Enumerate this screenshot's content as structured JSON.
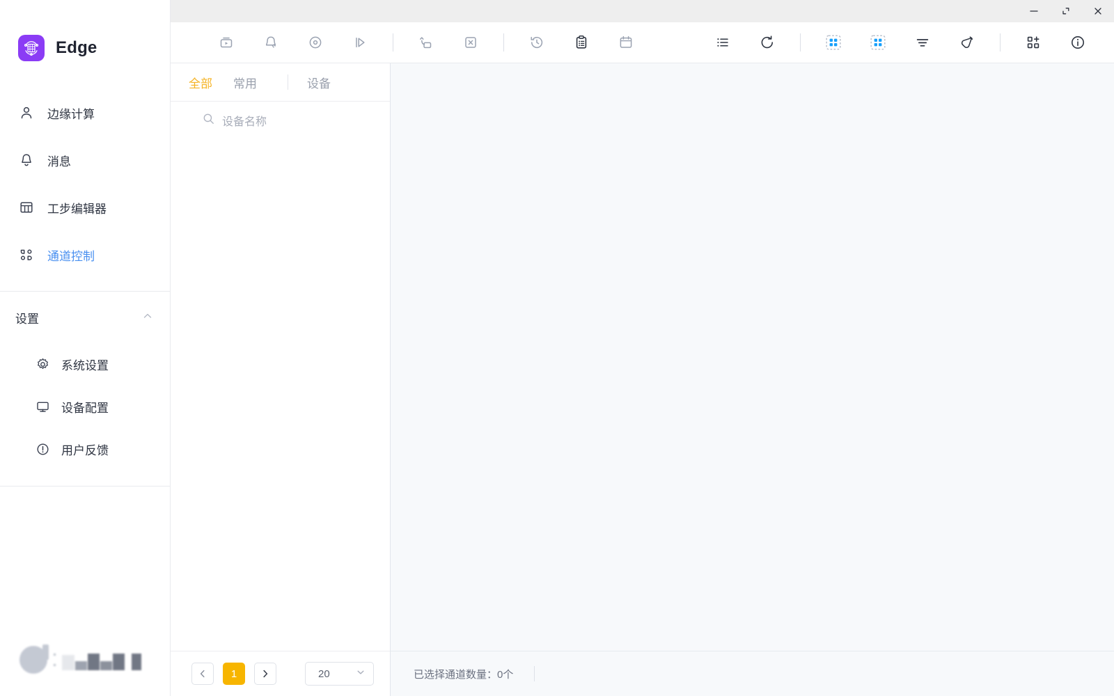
{
  "window": {
    "minimize_label": "minimize",
    "maximize_label": "maximize",
    "close_label": "close"
  },
  "brand": {
    "name": "Edge",
    "logo_color": "#8b3cf5",
    "logo_icon": "server-rotate-icon"
  },
  "sidebar": {
    "items": [
      {
        "label": "边缘计算",
        "icon": "user-icon",
        "active": false
      },
      {
        "label": "消息",
        "icon": "bell-icon",
        "active": false
      },
      {
        "label": "工步编辑器",
        "icon": "table-icon",
        "active": false
      },
      {
        "label": "通道控制",
        "icon": "channels-icon",
        "active": true
      }
    ],
    "settings": {
      "label": "设置",
      "collapse_icon": "chevron-up-icon",
      "items": [
        {
          "label": "系统设置",
          "icon": "gear-icon"
        },
        {
          "label": "设备配置",
          "icon": "monitor-icon"
        },
        {
          "label": "用户反馈",
          "icon": "exclamation-circle-icon"
        }
      ]
    },
    "active_color": "#4a90f0"
  },
  "toolbar": {
    "groups": [
      [
        {
          "name": "play-box-icon"
        },
        {
          "name": "bell-slash-icon"
        },
        {
          "name": "record-circle-icon"
        },
        {
          "name": "step-forward-icon"
        }
      ],
      [
        {
          "name": "export-icon"
        },
        {
          "name": "close-box-icon"
        }
      ],
      [
        {
          "name": "history-icon"
        },
        {
          "name": "clipboard-list-icon"
        },
        {
          "name": "calendar-icon"
        }
      ]
    ],
    "right_groups": [
      [
        {
          "name": "list-icon"
        },
        {
          "name": "reset-icon"
        }
      ],
      [
        {
          "name": "grid-select-icon",
          "highlight": true
        },
        {
          "name": "grid-deselect-icon",
          "highlight": true
        },
        {
          "name": "filter-icon"
        },
        {
          "name": "brush-icon"
        }
      ],
      [
        {
          "name": "add-grid-icon"
        },
        {
          "name": "info-icon"
        }
      ]
    ],
    "highlight_color": "#18a0fb"
  },
  "panel": {
    "tabs": [
      {
        "label": "全部",
        "active": true
      },
      {
        "label": "常用",
        "active": false
      }
    ],
    "device_tab": {
      "label": "设备"
    },
    "search": {
      "placeholder": "设备名称",
      "value": "",
      "icon": "search-icon"
    },
    "pagination": {
      "prev_icon": "chevron-left-icon",
      "next_icon": "chevron-right-icon",
      "current_page": "1",
      "page_size": "20",
      "page_size_icon": "chevron-down-icon"
    },
    "active_tab_color": "#f5b324"
  },
  "status": {
    "selected_channels_text": "已选择通道数量：0个"
  }
}
